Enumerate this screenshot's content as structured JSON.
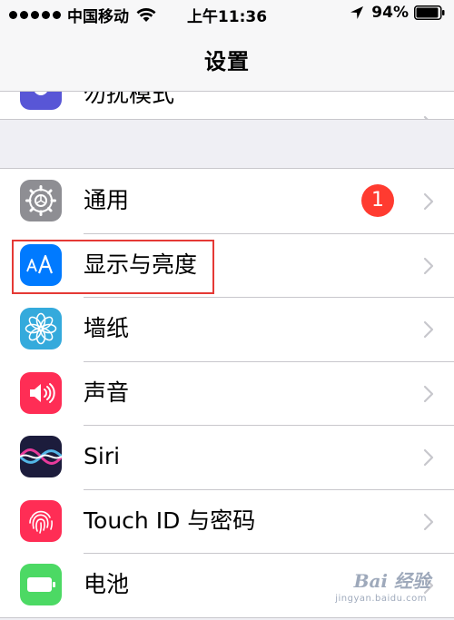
{
  "status_bar": {
    "carrier": "中国移动",
    "time": "上午11:36",
    "battery_percent": "94%",
    "battery_level": 0.94,
    "signal_bars": 5,
    "icons": [
      "signal-dots-icon",
      "wifi-icon",
      "location-arrow-icon",
      "battery-icon"
    ]
  },
  "nav": {
    "title": "设置"
  },
  "partial_row": {
    "label": "勿扰模式",
    "icon": "moon-icon",
    "icon_color": "#5856d6"
  },
  "settings": {
    "items": [
      {
        "label": "通用",
        "icon": "gear-icon",
        "icon_color": "#8e8e93",
        "badge": "1"
      },
      {
        "label": "显示与亮度",
        "icon": "text-size-icon",
        "icon_color": "#007aff"
      },
      {
        "label": "墙纸",
        "icon": "flower-icon",
        "icon_color": "#34aadc"
      },
      {
        "label": "声音",
        "icon": "speaker-icon",
        "icon_color": "#ff2d55"
      },
      {
        "label": "Siri",
        "icon": "siri-icon",
        "icon_color": "#1c1c3c"
      },
      {
        "label": "Touch ID 与密码",
        "icon": "fingerprint-icon",
        "icon_color": "#ff2d55"
      },
      {
        "label": "电池",
        "icon": "battery-icon",
        "icon_color": "#4cd964"
      }
    ]
  },
  "annotation": {
    "highlighted_item": "显示与亮度",
    "color": "#e53935"
  },
  "watermark": {
    "text": "Bai 经验",
    "sub": "jingyan.baidu.com"
  },
  "colors": {
    "badge": "#ff3b30",
    "background": "#efeff4",
    "separator": "#c8c7cc"
  }
}
